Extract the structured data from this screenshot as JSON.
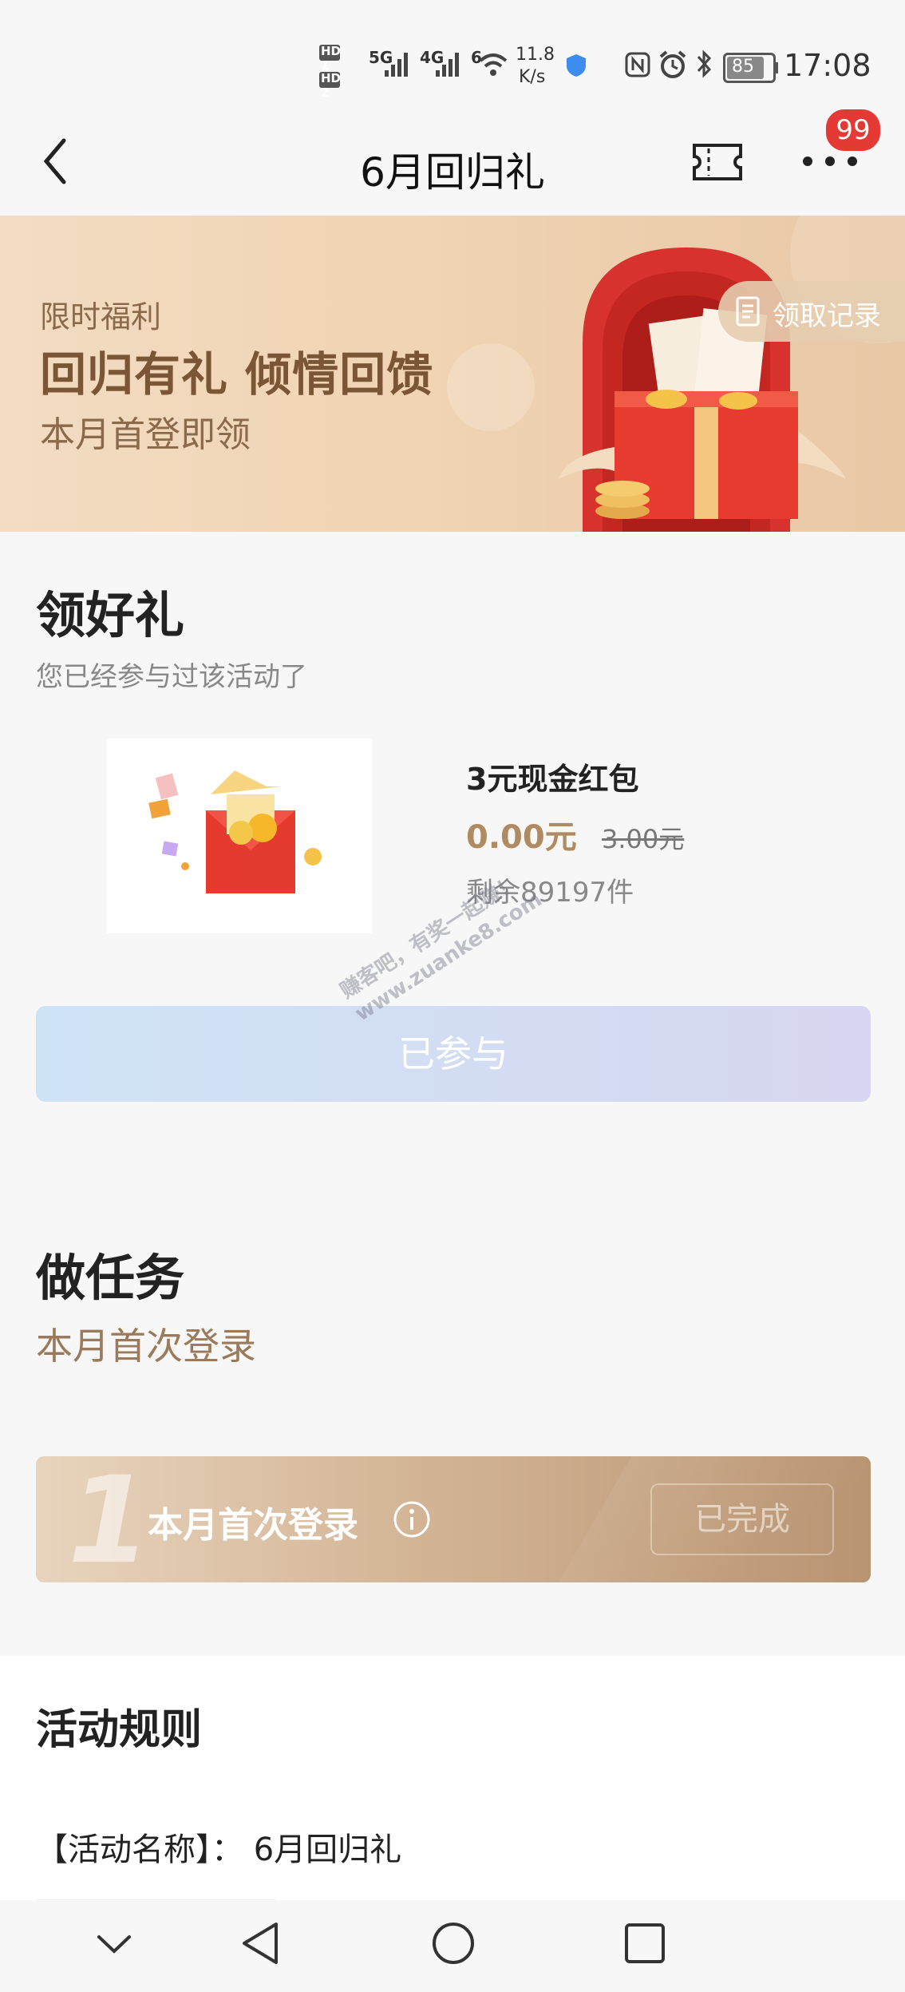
{
  "status_bar": {
    "hd1": "HD 1",
    "hd2": "HD 2",
    "net5g": "5G",
    "net4g": "4G",
    "wifi6": "6",
    "speed_value": "11.8",
    "speed_unit": "K/s",
    "battery": "85",
    "time": "17:08"
  },
  "header": {
    "title": "6月回归礼",
    "badge": "99"
  },
  "banner": {
    "tag": "限时福利",
    "headline": "回归有礼 倾情回馈",
    "subline": "本月首登即领",
    "record_button": "领取记录"
  },
  "gift_section": {
    "title": "领好礼",
    "status": "您已经参与过该活动了",
    "product": {
      "name": "3元现金红包",
      "price": "0.00元",
      "original_price": "3.00元",
      "stock": "剩余89197件"
    },
    "join_button": "已参与"
  },
  "task_section": {
    "title": "做任务",
    "subtitle": "本月首次登录",
    "task": {
      "number": "1",
      "label": "本月首次登录",
      "status_button": "已完成"
    }
  },
  "rules": {
    "title": "活动规则",
    "line1": "【活动名称】：  6月回归礼"
  },
  "watermark": {
    "line1": "赚客吧，有奖一起赚！",
    "line2": "www.zuanke8.com"
  },
  "colors": {
    "accent_gold": "#b08a60",
    "badge_red": "#e53935",
    "banner_bg": "#f0d4b4"
  }
}
